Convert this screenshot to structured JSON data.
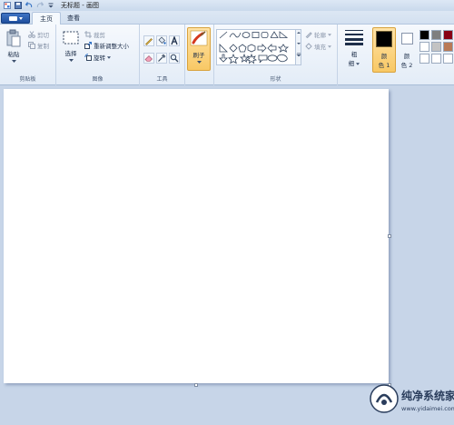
{
  "window": {
    "title": "无标题 - 画图"
  },
  "tabs": [
    {
      "label": "主页"
    },
    {
      "label": "查看"
    }
  ],
  "ribbon": {
    "clipboard": {
      "paste_label": "粘贴",
      "cut_label": "剪切",
      "copy_label": "复制",
      "group_label": "剪贴板"
    },
    "image": {
      "select_label": "选择",
      "crop_label": "裁剪",
      "resize_label": "重新调整大小",
      "rotate_label": "旋转",
      "group_label": "图像"
    },
    "tools": {
      "group_label": "工具"
    },
    "brushes": {
      "label": "刷子"
    },
    "shapes": {
      "outline_label": "轮廓",
      "fill_label": "填充",
      "group_label": "形状"
    },
    "size": {
      "label_line1": "粗",
      "label_line2": "细"
    },
    "colors": {
      "color1_line1": "颜",
      "color1_line2": "色 1",
      "color2_line1": "颜",
      "color2_line2": "色 2",
      "color1_value": "#000000",
      "color2_value": "#ffffff",
      "palette": [
        "#000000",
        "#7f7f7f",
        "#880015",
        "#ffffff",
        "#c3c3c3",
        "#b97a57",
        "#ffffff",
        "#ffffff",
        "#ffffff"
      ]
    }
  },
  "watermark": {
    "line1": "纯净系统家园",
    "line2": "www.yidaimei.com"
  }
}
